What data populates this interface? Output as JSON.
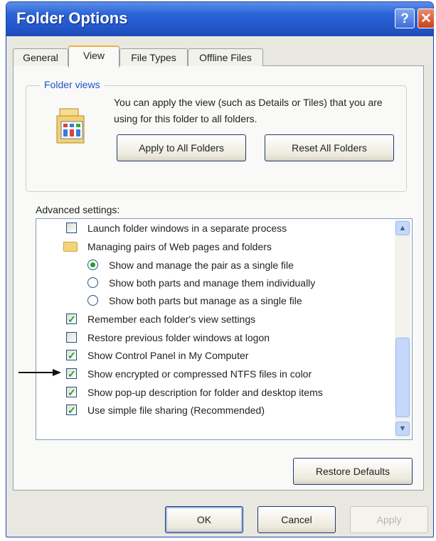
{
  "window": {
    "title": "Folder Options",
    "help_glyph": "?",
    "close_glyph": "✕"
  },
  "tabs": [
    {
      "label": "General",
      "active": false
    },
    {
      "label": "View",
      "active": true
    },
    {
      "label": "File Types",
      "active": false
    },
    {
      "label": "Offline Files",
      "active": false
    }
  ],
  "folder_views": {
    "label": "Folder views",
    "description": "You can apply the view (such as Details or Tiles) that you are using for this folder to all folders.",
    "apply_button": "Apply to All Folders",
    "reset_button": "Reset All Folders"
  },
  "advanced": {
    "label": "Advanced settings:",
    "items": [
      {
        "type": "checkbox",
        "checked": false,
        "text": "Launch folder windows in a separate process"
      },
      {
        "type": "folder",
        "text": "Managing pairs of Web pages and folders"
      },
      {
        "type": "radio",
        "selected": true,
        "text": "Show and manage the pair as a single file"
      },
      {
        "type": "radio",
        "selected": false,
        "text": "Show both parts and manage them individually"
      },
      {
        "type": "radio",
        "selected": false,
        "text": "Show both parts but manage as a single file"
      },
      {
        "type": "checkbox",
        "checked": true,
        "text": "Remember each folder's view settings"
      },
      {
        "type": "checkbox",
        "checked": false,
        "text": "Restore previous folder windows at logon"
      },
      {
        "type": "checkbox",
        "checked": true,
        "text": "Show Control Panel in My Computer"
      },
      {
        "type": "checkbox",
        "checked": true,
        "text": "Show encrypted or compressed NTFS files in color"
      },
      {
        "type": "checkbox",
        "checked": true,
        "text": "Show pop-up description for folder and desktop items"
      },
      {
        "type": "checkbox",
        "checked": true,
        "text": "Use simple file sharing (Recommended)"
      }
    ],
    "restore_button": "Restore Defaults"
  },
  "footer": {
    "ok": "OK",
    "cancel": "Cancel",
    "apply": "Apply"
  },
  "colors": {
    "titlebar": "#2458cc",
    "check": "#21a121",
    "group_label": "#1e57c6"
  }
}
